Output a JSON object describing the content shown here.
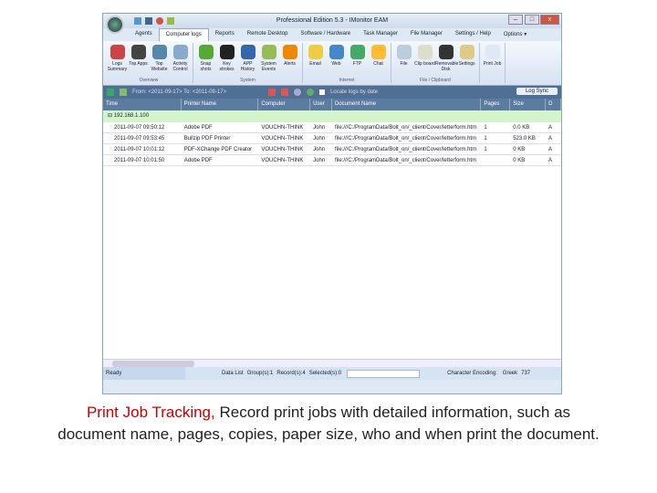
{
  "window": {
    "title": "Professional Edition 5.3 - IMonitor EAM",
    "minimize": "–",
    "maximize": "□",
    "close": "x"
  },
  "tabs": [
    "Agents",
    "Computer logs",
    "Reports",
    "Remote Desktop",
    "Software / Hardware",
    "Task Manager",
    "File Manager",
    "Settings / Help",
    "Options ▾"
  ],
  "ribbon": [
    {
      "label": "Overview",
      "buttons": [
        "Logs Summary",
        "Top Apps",
        "Top Website",
        "Activity Control"
      ],
      "colors": [
        "#c44",
        "#444",
        "#58a",
        "#8ac"
      ]
    },
    {
      "label": "System",
      "buttons": [
        "Snap shots",
        "Key strokes",
        "APP History",
        "System Events",
        "Alerts"
      ],
      "colors": [
        "#5a3",
        "#222",
        "#36a",
        "#9b5",
        "#e80"
      ]
    },
    {
      "label": "Internet",
      "buttons": [
        "Email",
        "Web",
        "FTP",
        "Chat"
      ],
      "colors": [
        "#ec4",
        "#48c",
        "#4a6",
        "#fb3"
      ]
    },
    {
      "label": "File / Clipboard",
      "buttons": [
        "File",
        "Clip board",
        "Removable Disk",
        "Settings"
      ],
      "colors": [
        "#bcd",
        "#ddc",
        "#333",
        "#dc8"
      ]
    },
    {
      "label": "",
      "buttons": [
        "Print Job"
      ],
      "colors": [
        "#dfe9f5"
      ]
    }
  ],
  "toolbar": {
    "date_range": "From: <2011-09-17> To: <2011-09-17>",
    "locate": "Locate logs by date",
    "log_sync": "Log Sync"
  },
  "columns": [
    "Time",
    "Printer Name",
    "Computer",
    "User",
    "Document Name",
    "Pages",
    "Size",
    "D"
  ],
  "group": "192.168.1.100",
  "rows": [
    [
      "2011-09-07 09:50:12",
      "Adobe PDF",
      "VOUCHN-THINK",
      "John",
      "file:///C:/ProgramData/Bolt_on/_client/Cover/letterform.htm",
      "1",
      "0.0 KB",
      "A"
    ],
    [
      "2011-09-07 09:53:45",
      "Bullzip PDF Printer",
      "VOUCHN-THINK",
      "John",
      "file:///C:/ProgramData/Bolt_on/_client/Cover/letterform.htm",
      "1",
      "523.0 KB",
      "A"
    ],
    [
      "2011-09-07 10:01:12",
      "PDF-XChange PDF Creator",
      "VOUCHN-THINK",
      "John",
      "file:///C:/ProgramData/Bolt_on/_client/Cover/letterform.htm",
      "1",
      "0 KB",
      "A"
    ],
    [
      "2011-09-07 10:01:50",
      "Adobe PDF",
      "VOUCHN-THINK",
      "John",
      "file:///C:/ProgramData/Bolt_on/_client/Cover/letterform.htm",
      "",
      "0 KB",
      "A"
    ]
  ],
  "status": {
    "ready": "Ready",
    "list": "Data List",
    "groups": "Group(s):1",
    "records": "Record(s):4",
    "selected": "Selected(s):0",
    "encoding": "Character Encoding:",
    "enc_value": "Greek",
    "code": "737"
  },
  "caption": {
    "highlight": "Print Job Tracking,",
    "text": " Record print jobs with detailed information, such as document name, pages, copies, paper size, who and when print the document."
  }
}
